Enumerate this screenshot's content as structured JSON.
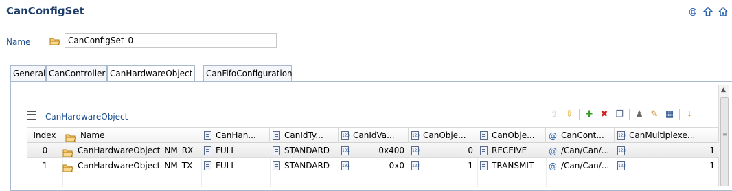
{
  "header": {
    "title": "CanConfigSet",
    "icons": [
      "at-icon",
      "arrow-up-icon",
      "home-icon"
    ]
  },
  "name_field": {
    "label": "Name",
    "value": "CanConfigSet_0"
  },
  "tabs": [
    {
      "label": "General"
    },
    {
      "label": "CanController"
    },
    {
      "label": "CanHardwareObject",
      "active": true
    },
    {
      "label": "CanFifoConfiguration"
    }
  ],
  "section": {
    "title": "CanHardwareObject"
  },
  "table": {
    "columns": [
      "Index",
      "Name",
      "CanHan...",
      "CanIdTy...",
      "CanIdVa...",
      "CanObje...",
      "CanObje...",
      "CanCont...",
      "CanMultiplexe..."
    ],
    "rows": [
      {
        "index": "0",
        "name": "CanHardwareObject_NM_RX",
        "canhan": "FULL",
        "canidtype": "STANDARD",
        "canidvalue": "0x400",
        "canobjectid": "0",
        "canobjecttype": "RECEIVE",
        "cancontroller": "/Can/Can/...",
        "canmultiplexed": "1"
      },
      {
        "index": "1",
        "name": "CanHardwareObject_NM_TX",
        "canhan": "FULL",
        "canidtype": "STANDARD",
        "canidvalue": "0x0",
        "canobjectid": "1",
        "canobjecttype": "TRANSMIT",
        "cancontroller": "/Can/Can/...",
        "canmultiplexed": "1"
      }
    ]
  },
  "colors": {
    "title": "#1f3f6a",
    "label_blue": "#1f4f8c",
    "tab_border": "#a9b9cf"
  }
}
